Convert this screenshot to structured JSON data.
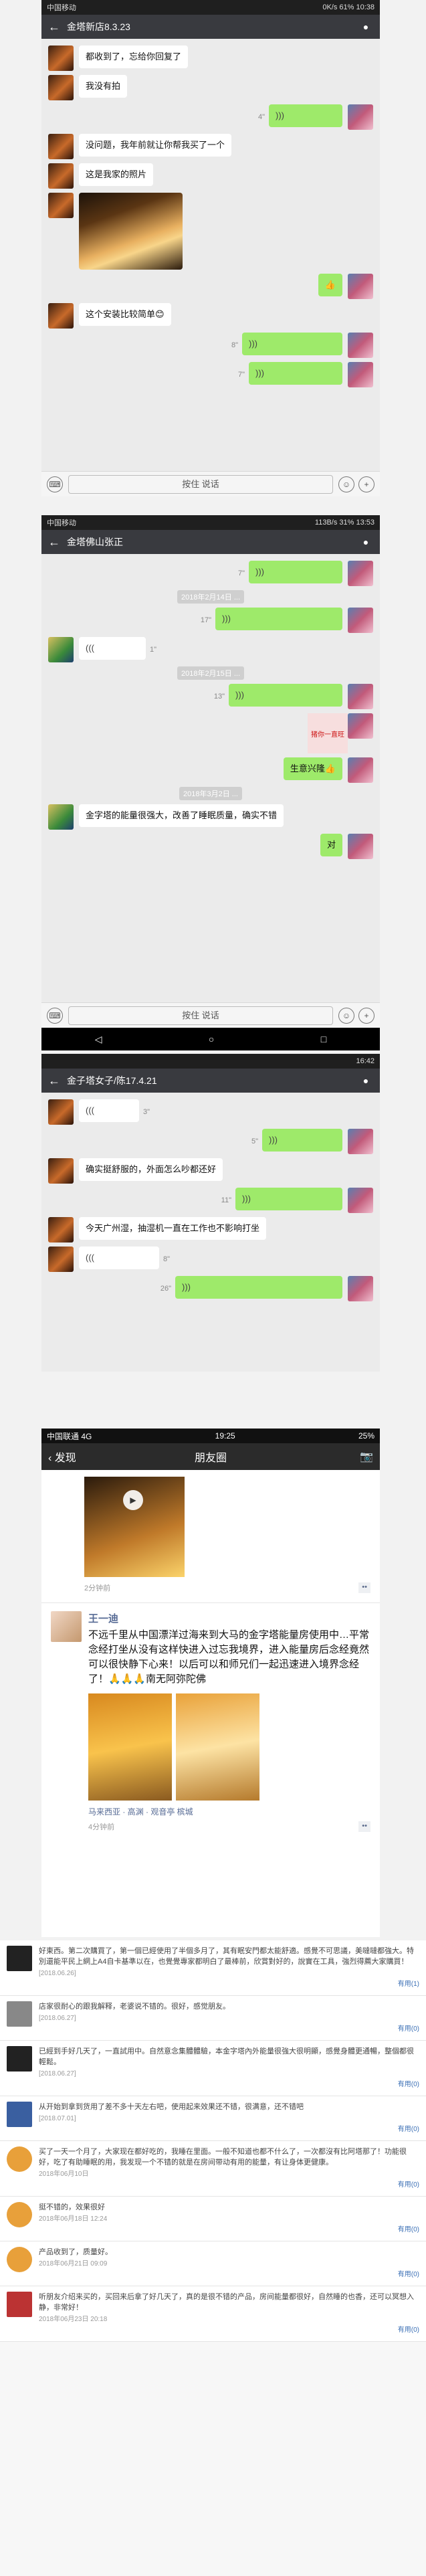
{
  "panel1": {
    "status_left": "中国移动",
    "status_right": "0K/s 61% 10:38",
    "title": "金塔新店8.3.23",
    "messages": [
      {
        "side": "in",
        "text": "都收到了，忘给你回复了"
      },
      {
        "side": "in",
        "text": "我没有拍"
      },
      {
        "side": "out",
        "voice": true,
        "dur": "4\""
      },
      {
        "side": "in",
        "text": "没问题，我年前就让你帮我买了一个"
      },
      {
        "side": "in",
        "text": "这是我家的照片"
      },
      {
        "side": "in",
        "photo": true
      },
      {
        "side": "out",
        "emoji": "👍"
      },
      {
        "side": "in",
        "text": "这个安装比较简单😊"
      },
      {
        "side": "out",
        "voice": true,
        "dur": "8\""
      },
      {
        "side": "out",
        "voice": true,
        "dur": "7\""
      }
    ],
    "hold_to_talk": "按住 说话"
  },
  "panel2": {
    "status_left": "中国移动",
    "status_right": "113B/s 31% 13:53",
    "title": "金塔佛山张正",
    "messages": [
      {
        "side": "out",
        "voice": true,
        "dur": "7\""
      },
      {
        "stamp": "2018年2月14日 ..."
      },
      {
        "side": "out",
        "voice": true,
        "dur": "17\""
      },
      {
        "side": "in",
        "voice": true,
        "dur": "1\""
      },
      {
        "stamp": "2018年2月15日 ..."
      },
      {
        "side": "out",
        "voice": true,
        "dur": "13\""
      },
      {
        "side": "out",
        "sticker": "猪你一直旺"
      },
      {
        "side": "out",
        "text": "生意兴隆👍"
      },
      {
        "stamp": "2018年3月2日 ..."
      },
      {
        "side": "in",
        "text": "金字塔的能量很强大，改善了睡眠质量，确实不错"
      },
      {
        "side": "out",
        "text": "对"
      }
    ],
    "hold_to_talk": "按住 说话"
  },
  "panel3": {
    "status_right": "16:42",
    "title": "金子塔女子/陈17.4.21",
    "messages": [
      {
        "side": "in",
        "voice": true,
        "dur": "3\""
      },
      {
        "side": "out",
        "voice": true,
        "dur": "5\""
      },
      {
        "side": "in",
        "text": "确实挺舒服的，外面怎么吵都还好"
      },
      {
        "side": "out",
        "voice": true,
        "dur": "11\""
      },
      {
        "side": "in",
        "text": "今天广州湿，抽湿机一直在工作也不影响打坐"
      },
      {
        "side": "in",
        "voice": true,
        "dur": "8\""
      },
      {
        "side": "out",
        "voice": true,
        "dur": "26\""
      }
    ]
  },
  "moments": {
    "status_left": "中国联通 4G",
    "status_time": "19:25",
    "status_right": "25%",
    "back_label": "发现",
    "title": "朋友圈",
    "time1": "2分钟前",
    "user": "王一迪",
    "post": "不远千里从中国漂洋过海来到大马的金字塔能量房使用中…平常念经打坐从没有这样快进入过忘我境界，进入能量房后念经竟然可以很快静下心来！以后可以和师兄们一起迅速进入境界念经了！🙏🙏🙏南无阿弥陀佛",
    "location": "马来西亚 · 高渊 · 观音亭 槟城",
    "time2": "4分钟前"
  },
  "comments": [
    {
      "text": "好東西。第二次購買了，第一個已經使用了半個多月了，其有眠安門都太能舒適。感覺不可思議，美噠噠都強大。特別還能平民上網上A4自卡基準以在，也覺覺專家都明白了最棒前，欣賞對好的，說實在工具，強烈得薦大家購買！",
      "meta": "[2018.06.26]",
      "act": "有用(1)"
    },
    {
      "text": "店家很耐心的跟我解释，老婆说不错的。很好，感觉朋友。",
      "meta": "[2018.06.27]",
      "act": "有用(0)"
    },
    {
      "text": "已經到手好几天了，一直試用中。自然意念集體體驗，本金字塔內外能量很強大很明顯，感覺身體更通暢，整個都很輕鬆。",
      "meta": "[2018.06.27]",
      "act": "有用(0)"
    },
    {
      "text": "从开始到拿到货用了差不多十天左右吧，使用起来效果还不错，很满意，还不错吧",
      "meta": "[2018.07.01]",
      "act": "有用(0)"
    },
    {
      "text": "买了一天一个月了，大家现在都好吃的，我睡在里面。一般不知道也都不什么了，一次都沒有比阿塔那了！功能很好，吃了有助睡眠的用，我发现一个不错的就是在房间带动有用的能量，有让身体更健康。",
      "meta": "2018年06月10日",
      "act": "有用(0)"
    },
    {
      "text": "挺不错的，效果很好",
      "meta": "2018年06月18日 12:24",
      "act": "有用(0)"
    },
    {
      "text": "产品收到了，质量好。",
      "meta": "2018年06月21日 09:09",
      "act": "有用(0)"
    },
    {
      "text": "听朋友介绍来买的，买回来后拿了好几天了，真的是很不错的产品，房间能量都很好，自然睡的也香，还可以冥想入静，非常好！",
      "meta": "2018年06月23日 20:18",
      "act": "有用(0)"
    }
  ]
}
